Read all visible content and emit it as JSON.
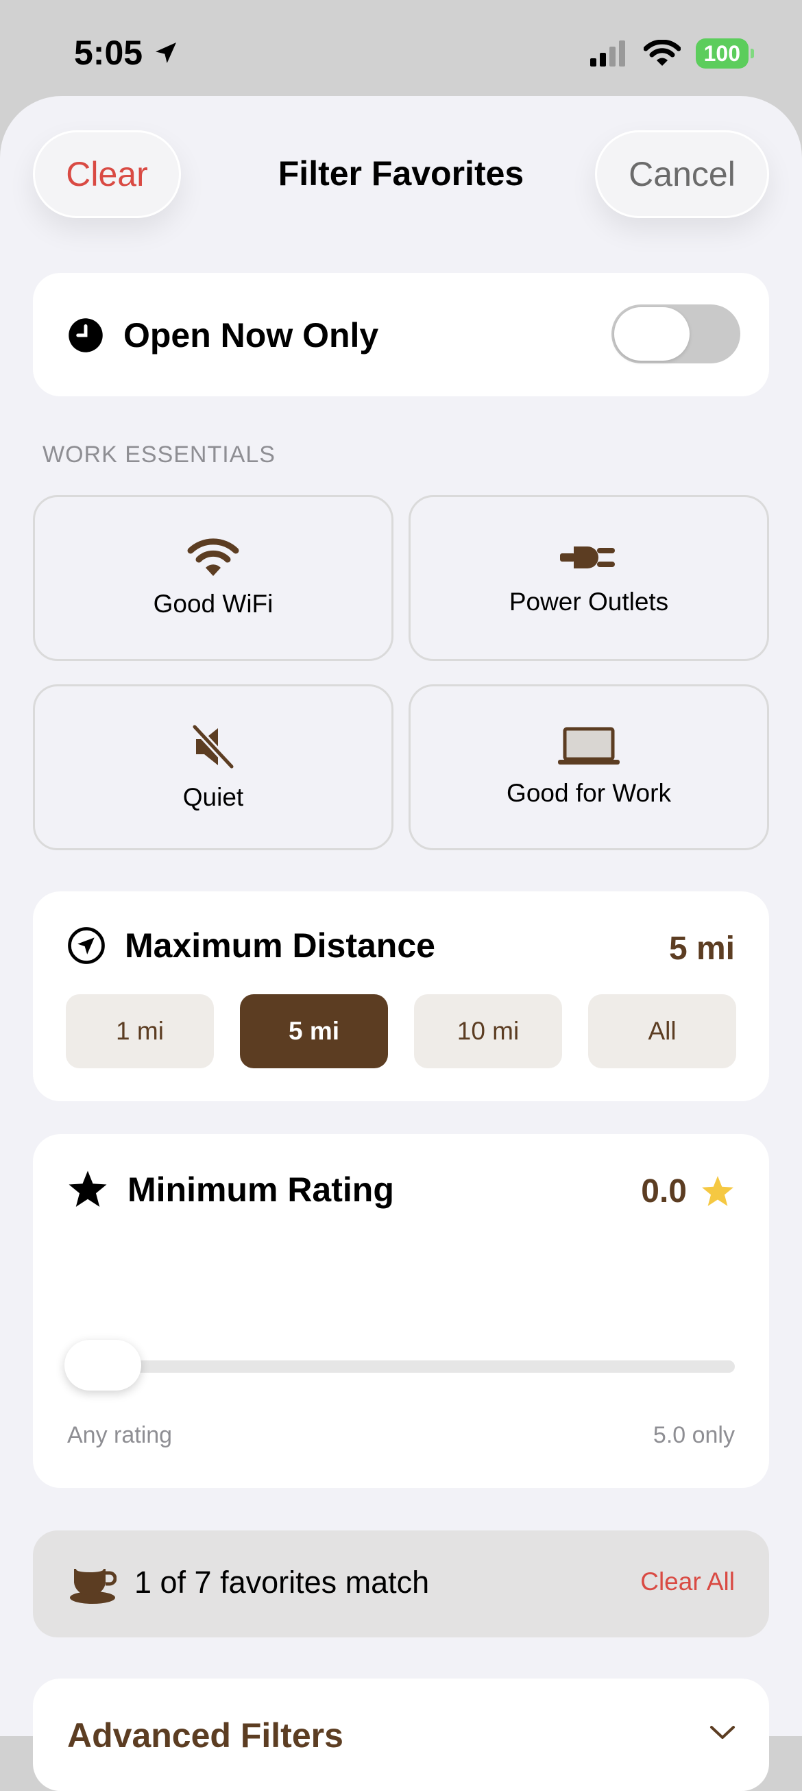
{
  "status_bar": {
    "time": "5:05",
    "battery": "100"
  },
  "header": {
    "clear_label": "Clear",
    "title": "Filter Favorites",
    "cancel_label": "Cancel"
  },
  "open_now": {
    "label": "Open Now Only",
    "enabled": false
  },
  "work_essentials": {
    "section_label": "WORK ESSENTIALS",
    "options": [
      {
        "label": "Good WiFi",
        "icon": "wifi-icon"
      },
      {
        "label": "Power Outlets",
        "icon": "plug-icon"
      },
      {
        "label": "Quiet",
        "icon": "speaker-muted-icon"
      },
      {
        "label": "Good for Work",
        "icon": "laptop-icon"
      }
    ]
  },
  "distance": {
    "label": "Maximum Distance",
    "value": "5 mi",
    "options": [
      "1 mi",
      "5 mi",
      "10 mi",
      "All"
    ],
    "selected": "5 mi"
  },
  "rating": {
    "label": "Minimum Rating",
    "value": "0.0",
    "slider_fraction": 0.0,
    "min_label": "Any rating",
    "max_label": "5.0 only"
  },
  "match": {
    "text": "1 of 7 favorites match",
    "clear_all_label": "Clear All"
  },
  "advanced": {
    "label": "Advanced Filters"
  },
  "colors": {
    "accent_brown": "#5c3d22",
    "destructive_red": "#d94a43",
    "star_yellow": "#f5c842"
  }
}
